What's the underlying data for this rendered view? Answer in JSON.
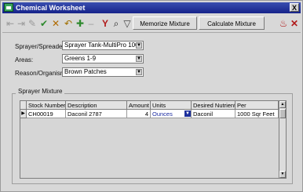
{
  "window": {
    "title": "Chemical Worksheet",
    "close_label": "X"
  },
  "toolbar": {
    "memorize_label": "Memorize Mixture",
    "calculate_label": "Calculate Mixture"
  },
  "form": {
    "sprayer_label": "Sprayer/Spreader:",
    "sprayer_value": "Sprayer Tank-MultiPro 1000",
    "areas_label": "Areas:",
    "areas_value": "Greens 1-9",
    "reason_label": "Reason/Organism:",
    "reason_value": "Brown Patches"
  },
  "mixture": {
    "group_title": "Sprayer Mixture",
    "columns": [
      "Stock Number",
      "Description",
      "Amount",
      "Units",
      "Desired Nutrient",
      "Per"
    ],
    "rows": [
      {
        "stock_number": "CH00019",
        "description": "Daconil 2787",
        "amount": "4",
        "units": "Ounces",
        "desired_nutrient": "Daconil",
        "per": "1000 Sqr Feet"
      }
    ]
  },
  "colors": {
    "title_bar": "#16238a",
    "units_selected": "#1a2aa0"
  }
}
